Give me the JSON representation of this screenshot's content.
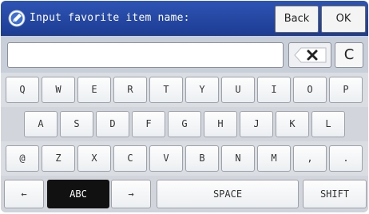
{
  "titlebar": {
    "title": "Input favorite item name:",
    "icon": "pencil-disc-icon",
    "back_label": "Back",
    "ok_label": "OK"
  },
  "input": {
    "value": "",
    "placeholder": "",
    "backspace_icon": "backspace-x-icon",
    "clear_label": "C"
  },
  "keyboard": {
    "row1": [
      "Q",
      "W",
      "E",
      "R",
      "T",
      "Y",
      "U",
      "I",
      "O",
      "P"
    ],
    "row2": [
      "A",
      "S",
      "D",
      "F",
      "G",
      "H",
      "J",
      "K",
      "L"
    ],
    "row3": [
      "@",
      "Z",
      "X",
      "C",
      "V",
      "B",
      "N",
      "M",
      ",",
      "."
    ],
    "bottom": {
      "left_arrow": "←",
      "mode": "ABC",
      "right_arrow": "→",
      "space": "SPACE",
      "shift": "SHIFT"
    }
  },
  "colors": {
    "titlebar": "#2448a8",
    "selected_key": "#111111"
  }
}
